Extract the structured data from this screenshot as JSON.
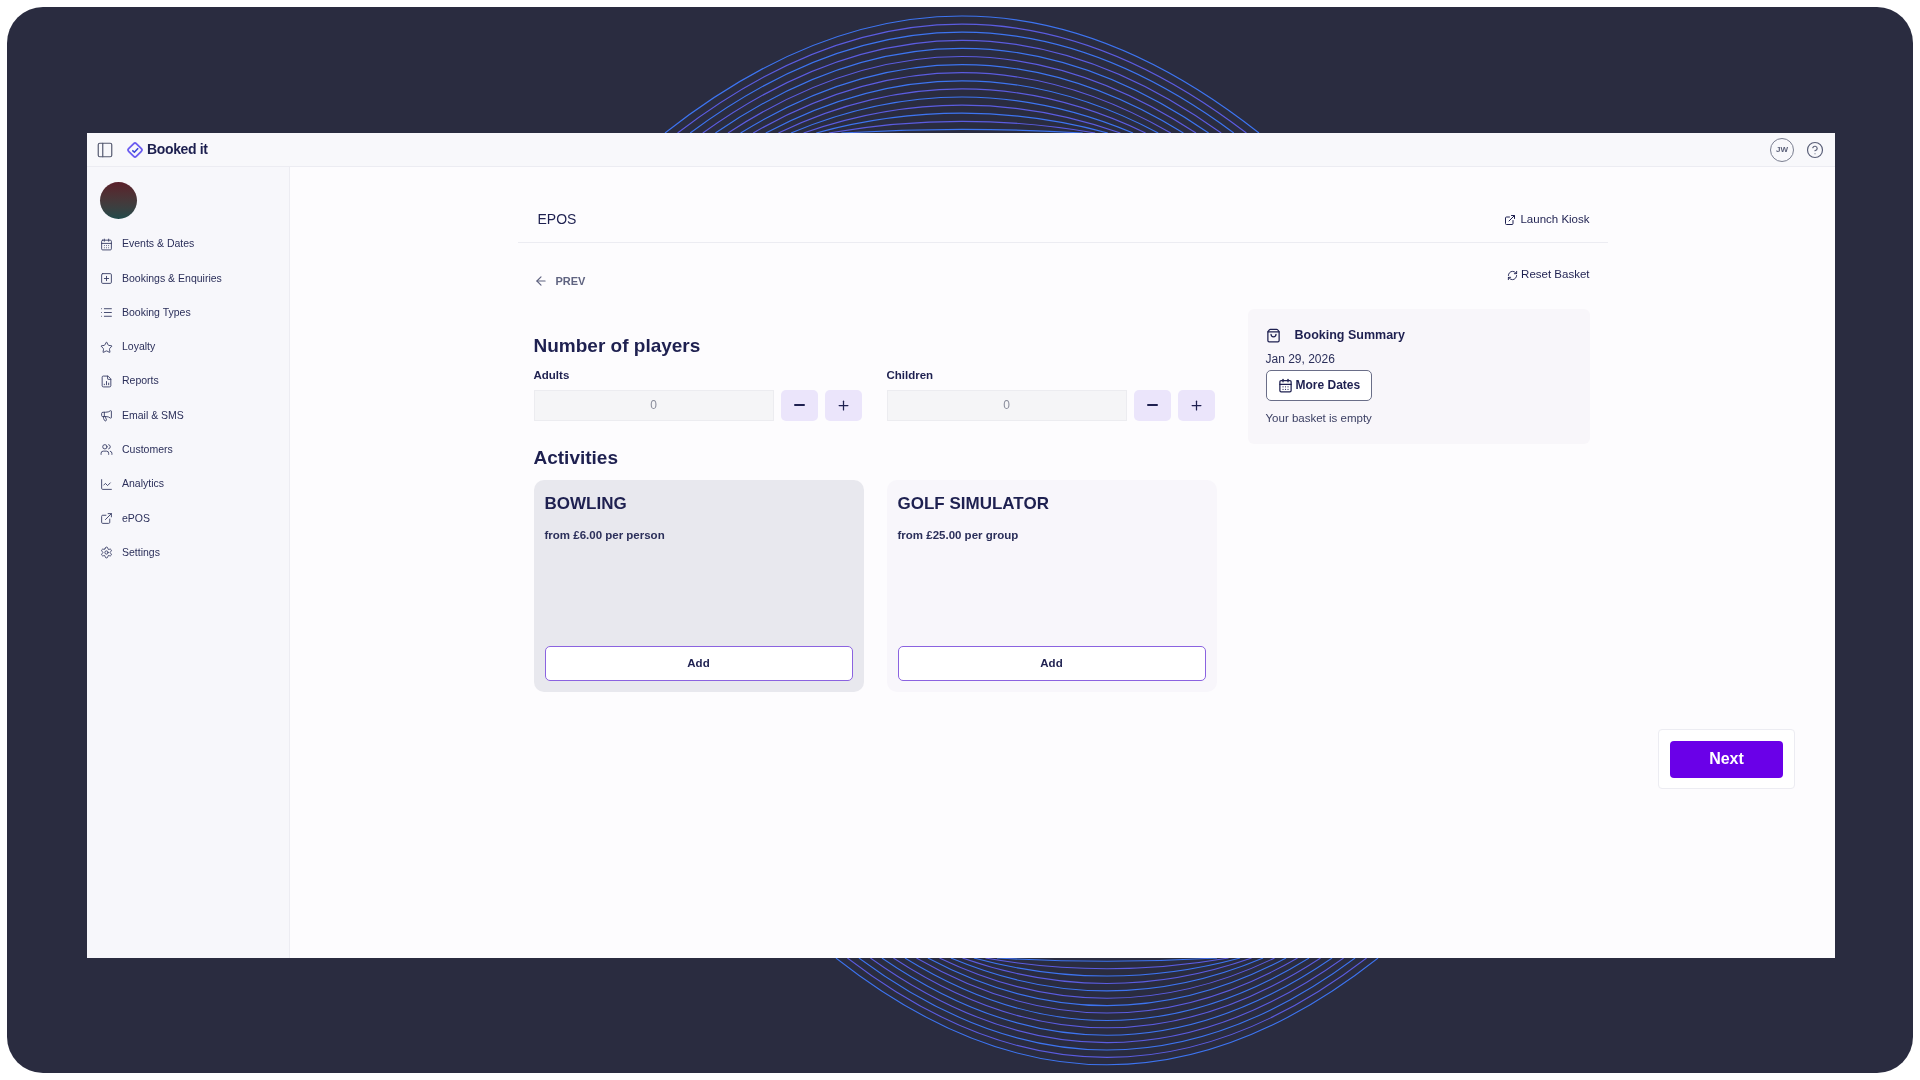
{
  "topbar": {
    "brand": "Booked it",
    "user_initials": "JW"
  },
  "sidebar": {
    "items": [
      {
        "label": "Events & Dates"
      },
      {
        "label": "Bookings & Enquiries"
      },
      {
        "label": "Booking Types"
      },
      {
        "label": "Loyalty"
      },
      {
        "label": "Reports"
      },
      {
        "label": "Email & SMS"
      },
      {
        "label": "Customers"
      },
      {
        "label": "Analytics"
      },
      {
        "label": "ePOS"
      },
      {
        "label": "Settings"
      }
    ]
  },
  "page": {
    "title": "EPOS",
    "launch": "Launch Kiosk",
    "prev": "PREV",
    "reset": "Reset Basket"
  },
  "players": {
    "title": "Number of players",
    "fields": [
      {
        "label": "Adults",
        "value": "0"
      },
      {
        "label": "Children",
        "value": "0"
      }
    ]
  },
  "activities": {
    "title": "Activities",
    "items": [
      {
        "name": "BOWLING",
        "price": "from £6.00 per person",
        "button": "Add",
        "selected": true
      },
      {
        "name": "GOLF SIMULATOR",
        "price": "from £25.00 per group",
        "button": "Add",
        "selected": false
      }
    ]
  },
  "summary": {
    "title": "Booking Summary",
    "date": "Jan 29, 2026",
    "more_dates": "More Dates",
    "empty": "Your basket is empty"
  },
  "next": "Next"
}
